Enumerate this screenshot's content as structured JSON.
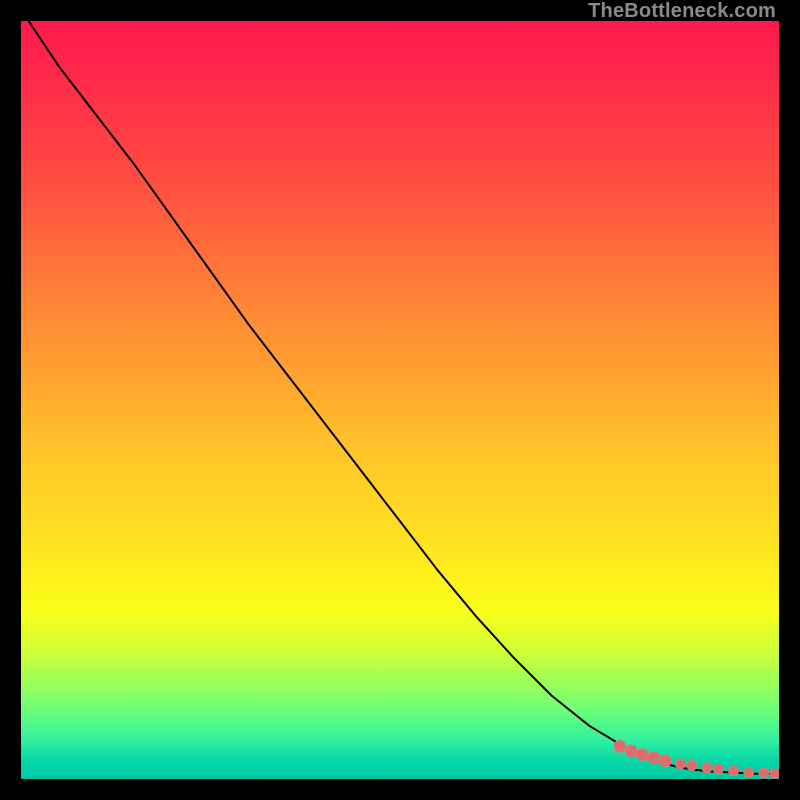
{
  "attribution": "TheBottleneck.com",
  "colors": {
    "line": "#000000",
    "marker_stroke": "#e07878",
    "marker_fill": "#d86e6e"
  },
  "chart_data": {
    "type": "line",
    "title": "",
    "xlabel": "",
    "ylabel": "",
    "xlim": [
      0,
      100
    ],
    "ylim": [
      0,
      100
    ],
    "series": [
      {
        "name": "curve",
        "x": [
          1,
          5,
          10,
          15,
          20,
          25,
          30,
          35,
          40,
          45,
          50,
          55,
          60,
          65,
          70,
          75,
          80,
          83,
          85,
          87,
          89,
          91,
          93,
          95,
          97,
          98,
          99,
          100
        ],
        "y": [
          100,
          94,
          87.5,
          81,
          74,
          67,
          60,
          53.5,
          47,
          40.5,
          34,
          27.5,
          21.5,
          16,
          11,
          7,
          4,
          2.7,
          2.0,
          1.5,
          1.2,
          1.0,
          0.9,
          0.8,
          0.7,
          0.7,
          0.7,
          0.6
        ]
      }
    ],
    "markers": {
      "name": "highlight-points",
      "x": [
        79,
        80.5,
        82,
        83.5,
        85,
        87,
        88.5,
        90.5,
        92,
        94,
        96,
        98,
        99.5
      ],
      "y": [
        4.3,
        3.7,
        3.2,
        2.8,
        2.4,
        2.0,
        1.8,
        1.5,
        1.3,
        1.1,
        0.9,
        0.8,
        0.7
      ],
      "r": [
        6,
        6,
        6,
        6,
        6,
        5,
        5,
        5,
        5,
        5,
        5,
        5,
        5
      ]
    }
  }
}
